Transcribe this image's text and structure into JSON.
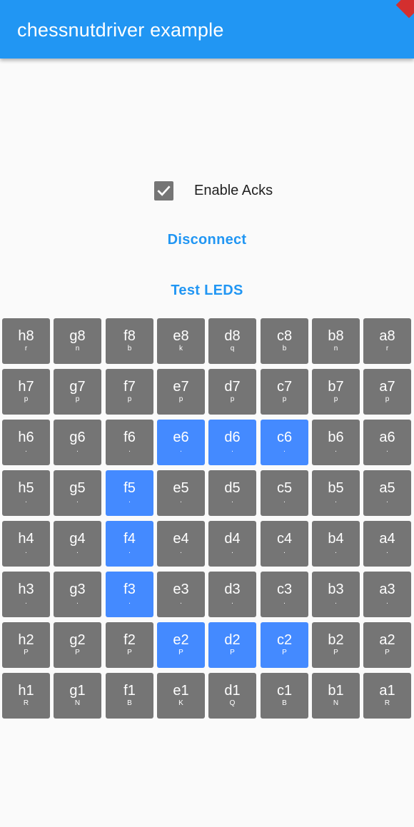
{
  "app_bar": {
    "title": "chessnutdriver example"
  },
  "controls": {
    "enable_acks_label": "Enable Acks",
    "enable_acks_checked": true,
    "disconnect_label": "Disconnect",
    "test_leds_label": "Test LEDS"
  },
  "colors": {
    "primary": "#2196f3",
    "square": "#757575",
    "square_lit": "#448aff",
    "background": "#fafafa"
  },
  "board": {
    "rows": [
      [
        {
          "name": "h8",
          "piece": "r",
          "lit": false
        },
        {
          "name": "g8",
          "piece": "n",
          "lit": false
        },
        {
          "name": "f8",
          "piece": "b",
          "lit": false
        },
        {
          "name": "e8",
          "piece": "k",
          "lit": false
        },
        {
          "name": "d8",
          "piece": "q",
          "lit": false
        },
        {
          "name": "c8",
          "piece": "b",
          "lit": false
        },
        {
          "name": "b8",
          "piece": "n",
          "lit": false
        },
        {
          "name": "a8",
          "piece": "r",
          "lit": false
        }
      ],
      [
        {
          "name": "h7",
          "piece": "p",
          "lit": false
        },
        {
          "name": "g7",
          "piece": "p",
          "lit": false
        },
        {
          "name": "f7",
          "piece": "p",
          "lit": false
        },
        {
          "name": "e7",
          "piece": "p",
          "lit": false
        },
        {
          "name": "d7",
          "piece": "p",
          "lit": false
        },
        {
          "name": "c7",
          "piece": "p",
          "lit": false
        },
        {
          "name": "b7",
          "piece": "p",
          "lit": false
        },
        {
          "name": "a7",
          "piece": "p",
          "lit": false
        }
      ],
      [
        {
          "name": "h6",
          "piece": ".",
          "lit": false
        },
        {
          "name": "g6",
          "piece": ".",
          "lit": false
        },
        {
          "name": "f6",
          "piece": ".",
          "lit": false
        },
        {
          "name": "e6",
          "piece": ".",
          "lit": true
        },
        {
          "name": "d6",
          "piece": ".",
          "lit": true
        },
        {
          "name": "c6",
          "piece": ".",
          "lit": true
        },
        {
          "name": "b6",
          "piece": ".",
          "lit": false
        },
        {
          "name": "a6",
          "piece": ".",
          "lit": false
        }
      ],
      [
        {
          "name": "h5",
          "piece": ".",
          "lit": false
        },
        {
          "name": "g5",
          "piece": ".",
          "lit": false
        },
        {
          "name": "f5",
          "piece": ".",
          "lit": true
        },
        {
          "name": "e5",
          "piece": ".",
          "lit": false
        },
        {
          "name": "d5",
          "piece": ".",
          "lit": false
        },
        {
          "name": "c5",
          "piece": ".",
          "lit": false
        },
        {
          "name": "b5",
          "piece": ".",
          "lit": false
        },
        {
          "name": "a5",
          "piece": ".",
          "lit": false
        }
      ],
      [
        {
          "name": "h4",
          "piece": ".",
          "lit": false
        },
        {
          "name": "g4",
          "piece": ".",
          "lit": false
        },
        {
          "name": "f4",
          "piece": ".",
          "lit": true
        },
        {
          "name": "e4",
          "piece": ".",
          "lit": false
        },
        {
          "name": "d4",
          "piece": ".",
          "lit": false
        },
        {
          "name": "c4",
          "piece": ".",
          "lit": false
        },
        {
          "name": "b4",
          "piece": ".",
          "lit": false
        },
        {
          "name": "a4",
          "piece": ".",
          "lit": false
        }
      ],
      [
        {
          "name": "h3",
          "piece": ".",
          "lit": false
        },
        {
          "name": "g3",
          "piece": ".",
          "lit": false
        },
        {
          "name": "f3",
          "piece": ".",
          "lit": true
        },
        {
          "name": "e3",
          "piece": ".",
          "lit": false
        },
        {
          "name": "d3",
          "piece": ".",
          "lit": false
        },
        {
          "name": "c3",
          "piece": ".",
          "lit": false
        },
        {
          "name": "b3",
          "piece": ".",
          "lit": false
        },
        {
          "name": "a3",
          "piece": ".",
          "lit": false
        }
      ],
      [
        {
          "name": "h2",
          "piece": "P",
          "lit": false
        },
        {
          "name": "g2",
          "piece": "P",
          "lit": false
        },
        {
          "name": "f2",
          "piece": "P",
          "lit": false
        },
        {
          "name": "e2",
          "piece": "P",
          "lit": true
        },
        {
          "name": "d2",
          "piece": "P",
          "lit": true
        },
        {
          "name": "c2",
          "piece": "P",
          "lit": true
        },
        {
          "name": "b2",
          "piece": "P",
          "lit": false
        },
        {
          "name": "a2",
          "piece": "P",
          "lit": false
        }
      ],
      [
        {
          "name": "h1",
          "piece": "R",
          "lit": false
        },
        {
          "name": "g1",
          "piece": "N",
          "lit": false
        },
        {
          "name": "f1",
          "piece": "B",
          "lit": false
        },
        {
          "name": "e1",
          "piece": "K",
          "lit": false
        },
        {
          "name": "d1",
          "piece": "Q",
          "lit": false
        },
        {
          "name": "c1",
          "piece": "B",
          "lit": false
        },
        {
          "name": "b1",
          "piece": "N",
          "lit": false
        },
        {
          "name": "a1",
          "piece": "R",
          "lit": false
        }
      ]
    ]
  }
}
